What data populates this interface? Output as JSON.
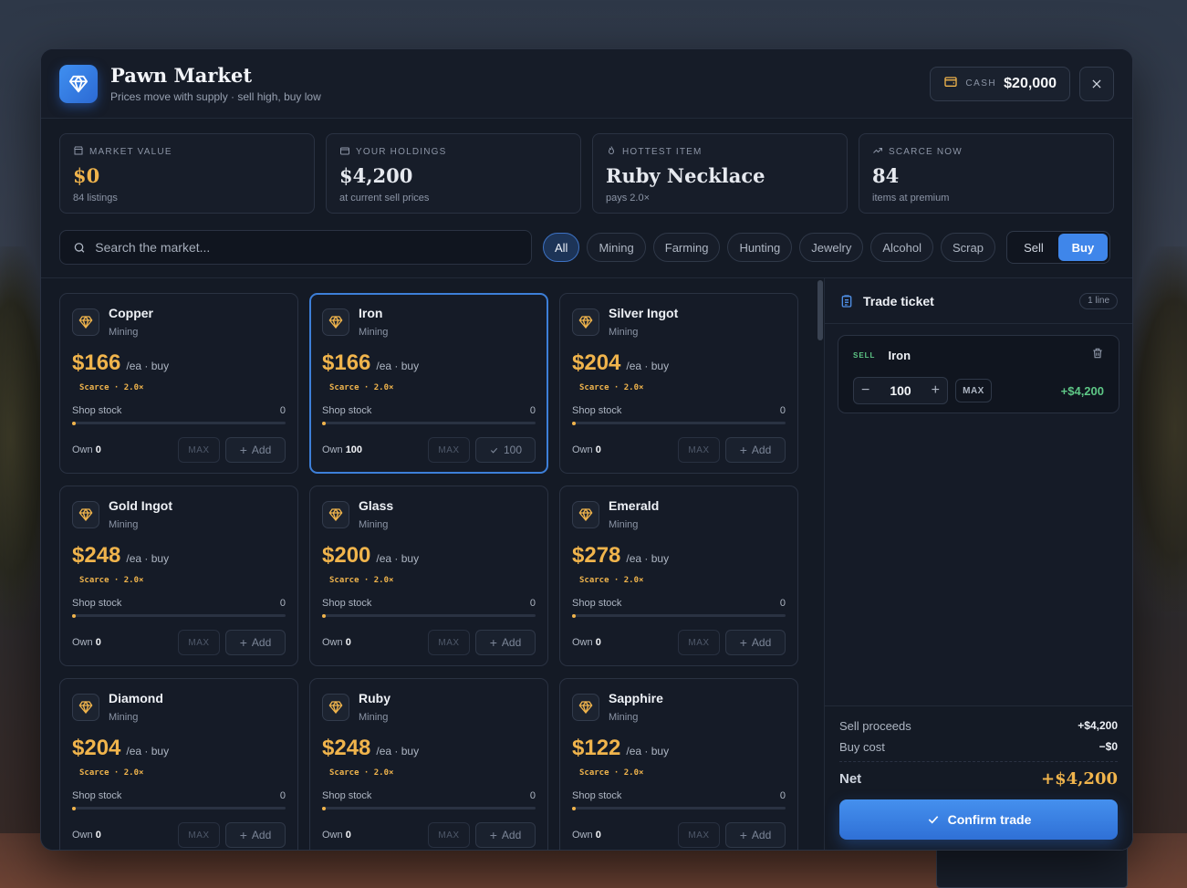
{
  "header": {
    "title": "Pawn Market",
    "subtitle": "Prices move with supply · sell high, buy low",
    "cash_label": "CASH",
    "cash_value": "$20,000"
  },
  "stats": [
    {
      "label": "MARKET VALUE",
      "value": "$0",
      "sub": "84 listings",
      "icon": "store-icon",
      "gold": true
    },
    {
      "label": "YOUR HOLDINGS",
      "value": "$4,200",
      "sub": "at current sell prices",
      "icon": "wallet-icon",
      "gold": false
    },
    {
      "label": "HOTTEST ITEM",
      "value": "Ruby Necklace",
      "sub": "pays 2.0×",
      "icon": "flame-icon",
      "gold": false
    },
    {
      "label": "SCARCE NOW",
      "value": "84",
      "sub": "items at premium",
      "icon": "trend-up-icon",
      "gold": false
    }
  ],
  "search": {
    "placeholder": "Search the market..."
  },
  "filters": [
    "All",
    "Mining",
    "Farming",
    "Hunting",
    "Jewelry",
    "Alcohol",
    "Scrap"
  ],
  "active_filter": "All",
  "mode": {
    "sell": "Sell",
    "buy": "Buy",
    "active": "Buy"
  },
  "card_labels": {
    "unit": "/ea · buy",
    "scarce": "Scarce · 2.0×",
    "stock": "Shop stock",
    "own": "Own",
    "max": "MAX",
    "add": "Add"
  },
  "items": [
    {
      "name": "Copper",
      "category": "Mining",
      "price": "$166",
      "stock": "0",
      "own": "0",
      "selected": false,
      "stock_fraction": 0.0
    },
    {
      "name": "Iron",
      "category": "Mining",
      "price": "$166",
      "stock": "0",
      "own": "100",
      "selected": true,
      "action": "100",
      "stock_fraction": 0.0
    },
    {
      "name": "Silver Ingot",
      "category": "Mining",
      "price": "$204",
      "stock": "0",
      "own": "0",
      "selected": false,
      "stock_fraction": 0.0
    },
    {
      "name": "Gold Ingot",
      "category": "Mining",
      "price": "$248",
      "stock": "0",
      "own": "0",
      "selected": false,
      "stock_fraction": 0.0
    },
    {
      "name": "Glass",
      "category": "Mining",
      "price": "$200",
      "stock": "0",
      "own": "0",
      "selected": false,
      "stock_fraction": 0.0
    },
    {
      "name": "Emerald",
      "category": "Mining",
      "price": "$278",
      "stock": "0",
      "own": "0",
      "selected": false,
      "stock_fraction": 0.0
    },
    {
      "name": "Diamond",
      "category": "Mining",
      "price": "$204",
      "stock": "0",
      "own": "0",
      "selected": false,
      "stock_fraction": 0.0
    },
    {
      "name": "Ruby",
      "category": "Mining",
      "price": "$248",
      "stock": "0",
      "own": "0",
      "selected": false,
      "stock_fraction": 0.0
    },
    {
      "name": "Sapphire",
      "category": "Mining",
      "price": "$122",
      "stock": "0",
      "own": "0",
      "selected": false,
      "stock_fraction": 0.0
    }
  ],
  "ticket": {
    "title": "Trade ticket",
    "badge": "1 line",
    "line": {
      "side": "SELL",
      "name": "Iron",
      "qty": "100",
      "max": "MAX",
      "amount": "+$4,200"
    },
    "sell_proceeds_label": "Sell proceeds",
    "sell_proceeds": "+$4,200",
    "buy_cost_label": "Buy cost",
    "buy_cost": "−$0",
    "net_label": "Net",
    "net": "+$4,200",
    "confirm": "Confirm trade"
  },
  "colors": {
    "accent": "#3f86ea",
    "gold": "#f0b44c",
    "green": "#5ec786"
  }
}
